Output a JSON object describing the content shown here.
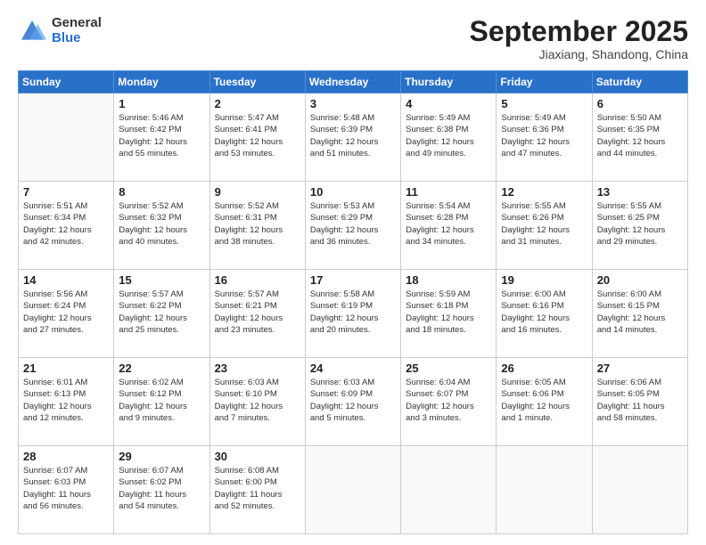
{
  "header": {
    "logo_general": "General",
    "logo_blue": "Blue",
    "month_title": "September 2025",
    "location": "Jiaxiang, Shandong, China"
  },
  "weekdays": [
    "Sunday",
    "Monday",
    "Tuesday",
    "Wednesday",
    "Thursday",
    "Friday",
    "Saturday"
  ],
  "weeks": [
    [
      {
        "day": "",
        "info": ""
      },
      {
        "day": "1",
        "info": "Sunrise: 5:46 AM\nSunset: 6:42 PM\nDaylight: 12 hours\nand 55 minutes."
      },
      {
        "day": "2",
        "info": "Sunrise: 5:47 AM\nSunset: 6:41 PM\nDaylight: 12 hours\nand 53 minutes."
      },
      {
        "day": "3",
        "info": "Sunrise: 5:48 AM\nSunset: 6:39 PM\nDaylight: 12 hours\nand 51 minutes."
      },
      {
        "day": "4",
        "info": "Sunrise: 5:49 AM\nSunset: 6:38 PM\nDaylight: 12 hours\nand 49 minutes."
      },
      {
        "day": "5",
        "info": "Sunrise: 5:49 AM\nSunset: 6:36 PM\nDaylight: 12 hours\nand 47 minutes."
      },
      {
        "day": "6",
        "info": "Sunrise: 5:50 AM\nSunset: 6:35 PM\nDaylight: 12 hours\nand 44 minutes."
      }
    ],
    [
      {
        "day": "7",
        "info": "Sunrise: 5:51 AM\nSunset: 6:34 PM\nDaylight: 12 hours\nand 42 minutes."
      },
      {
        "day": "8",
        "info": "Sunrise: 5:52 AM\nSunset: 6:32 PM\nDaylight: 12 hours\nand 40 minutes."
      },
      {
        "day": "9",
        "info": "Sunrise: 5:52 AM\nSunset: 6:31 PM\nDaylight: 12 hours\nand 38 minutes."
      },
      {
        "day": "10",
        "info": "Sunrise: 5:53 AM\nSunset: 6:29 PM\nDaylight: 12 hours\nand 36 minutes."
      },
      {
        "day": "11",
        "info": "Sunrise: 5:54 AM\nSunset: 6:28 PM\nDaylight: 12 hours\nand 34 minutes."
      },
      {
        "day": "12",
        "info": "Sunrise: 5:55 AM\nSunset: 6:26 PM\nDaylight: 12 hours\nand 31 minutes."
      },
      {
        "day": "13",
        "info": "Sunrise: 5:55 AM\nSunset: 6:25 PM\nDaylight: 12 hours\nand 29 minutes."
      }
    ],
    [
      {
        "day": "14",
        "info": "Sunrise: 5:56 AM\nSunset: 6:24 PM\nDaylight: 12 hours\nand 27 minutes."
      },
      {
        "day": "15",
        "info": "Sunrise: 5:57 AM\nSunset: 6:22 PM\nDaylight: 12 hours\nand 25 minutes."
      },
      {
        "day": "16",
        "info": "Sunrise: 5:57 AM\nSunset: 6:21 PM\nDaylight: 12 hours\nand 23 minutes."
      },
      {
        "day": "17",
        "info": "Sunrise: 5:58 AM\nSunset: 6:19 PM\nDaylight: 12 hours\nand 20 minutes."
      },
      {
        "day": "18",
        "info": "Sunrise: 5:59 AM\nSunset: 6:18 PM\nDaylight: 12 hours\nand 18 minutes."
      },
      {
        "day": "19",
        "info": "Sunrise: 6:00 AM\nSunset: 6:16 PM\nDaylight: 12 hours\nand 16 minutes."
      },
      {
        "day": "20",
        "info": "Sunrise: 6:00 AM\nSunset: 6:15 PM\nDaylight: 12 hours\nand 14 minutes."
      }
    ],
    [
      {
        "day": "21",
        "info": "Sunrise: 6:01 AM\nSunset: 6:13 PM\nDaylight: 12 hours\nand 12 minutes."
      },
      {
        "day": "22",
        "info": "Sunrise: 6:02 AM\nSunset: 6:12 PM\nDaylight: 12 hours\nand 9 minutes."
      },
      {
        "day": "23",
        "info": "Sunrise: 6:03 AM\nSunset: 6:10 PM\nDaylight: 12 hours\nand 7 minutes."
      },
      {
        "day": "24",
        "info": "Sunrise: 6:03 AM\nSunset: 6:09 PM\nDaylight: 12 hours\nand 5 minutes."
      },
      {
        "day": "25",
        "info": "Sunrise: 6:04 AM\nSunset: 6:07 PM\nDaylight: 12 hours\nand 3 minutes."
      },
      {
        "day": "26",
        "info": "Sunrise: 6:05 AM\nSunset: 6:06 PM\nDaylight: 12 hours\nand 1 minute."
      },
      {
        "day": "27",
        "info": "Sunrise: 6:06 AM\nSunset: 6:05 PM\nDaylight: 11 hours\nand 58 minutes."
      }
    ],
    [
      {
        "day": "28",
        "info": "Sunrise: 6:07 AM\nSunset: 6:03 PM\nDaylight: 11 hours\nand 56 minutes."
      },
      {
        "day": "29",
        "info": "Sunrise: 6:07 AM\nSunset: 6:02 PM\nDaylight: 11 hours\nand 54 minutes."
      },
      {
        "day": "30",
        "info": "Sunrise: 6:08 AM\nSunset: 6:00 PM\nDaylight: 11 hours\nand 52 minutes."
      },
      {
        "day": "",
        "info": ""
      },
      {
        "day": "",
        "info": ""
      },
      {
        "day": "",
        "info": ""
      },
      {
        "day": "",
        "info": ""
      }
    ]
  ]
}
